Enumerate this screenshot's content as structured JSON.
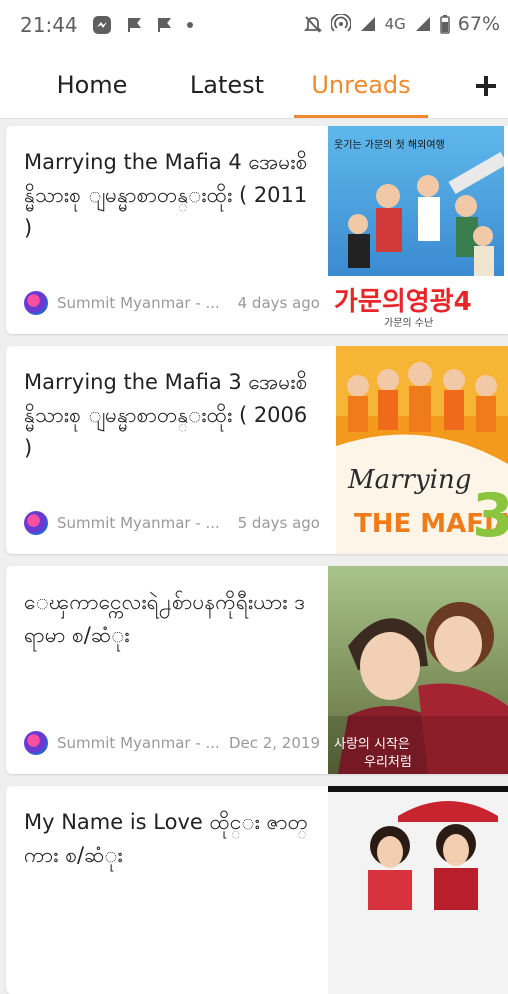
{
  "status_bar": {
    "time": "21:44",
    "network": "4G",
    "battery": "67%"
  },
  "tabs": [
    {
      "label": "Home"
    },
    {
      "label": "Latest"
    },
    {
      "label": "Unreads"
    }
  ],
  "accent_color": "#ef8a2c",
  "articles": [
    {
      "title": "Marrying the Mafia 4 အေမးစိန္မိသားစု ျမန္မာစာတန္းထိုး ( 2011 )",
      "source": "Summit Myanmar - ...",
      "time": "4 days ago",
      "thumb_text_main": "가문의영광4",
      "thumb_text_sub": "가문의 수난",
      "thumb_text_top": "웃기는 가문의 첫 해외여행"
    },
    {
      "title": "Marrying the Mafia 3 အေမးစိန္မိသားစု ျမန္မာစာတန္းထိုး ( 2006 )",
      "source": "Summit Myanmar - ...",
      "time": "5 days ago",
      "thumb_text_main": "Marrying",
      "thumb_text_sub": "THE MAFIA",
      "thumb_text_num": "3"
    },
    {
      "title": "ေၾကာင္ကေလးရဲ႕စ်ာပနကိုရီးယား ဒရာမာ စ/ဆံုး",
      "source": "Summit Myanmar - ...",
      "time": "Dec 2, 2019",
      "thumb_text_main": "사랑의 시작은",
      "thumb_text_sub": "우리처럼"
    },
    {
      "title": "My Name is Love ထိုင္း ဇာတ္ကား စ/ဆံုး",
      "source": "",
      "time": ""
    }
  ]
}
